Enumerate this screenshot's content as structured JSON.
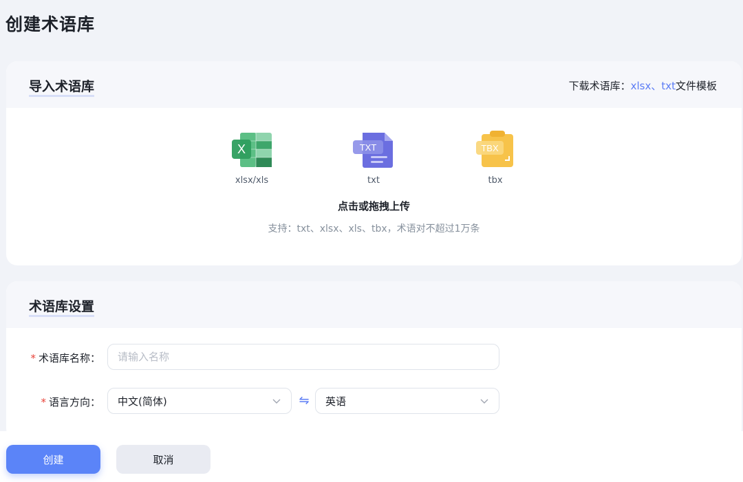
{
  "page": {
    "title": "创建术语库"
  },
  "import_section": {
    "title": "导入术语库",
    "download": {
      "prefix": "下载术语库：",
      "link_xlsx": "xlsx",
      "separator": "、",
      "link_txt": "txt",
      "suffix": "文件模板"
    },
    "file_types": [
      {
        "label": "xlsx/xls",
        "icon": "excel-file-icon",
        "icon_text": "X",
        "color": "#2e9e5e"
      },
      {
        "label": "txt",
        "icon": "txt-file-icon",
        "icon_text": "TXT",
        "color": "#5f63d8"
      },
      {
        "label": "tbx",
        "icon": "tbx-file-icon",
        "icon_text": "TBX",
        "color": "#f6c343"
      }
    ],
    "upload_title": "点击或拖拽上传",
    "upload_hint": "支持：txt、xlsx、xls、tbx，术语对不超过1万条"
  },
  "settings_section": {
    "title": "术语库设置",
    "name_field": {
      "required_mark": "*",
      "label": "术语库名称：",
      "placeholder": "请输入名称",
      "value": ""
    },
    "language_field": {
      "required_mark": "*",
      "label": "语言方向：",
      "source": "中文(简体)",
      "target": "英语",
      "swap_icon": "⇋"
    }
  },
  "footer": {
    "create_label": "创建",
    "cancel_label": "取消"
  },
  "colors": {
    "accent": "#5b84f8",
    "link": "#5b7cf5",
    "required": "#e8443a"
  }
}
